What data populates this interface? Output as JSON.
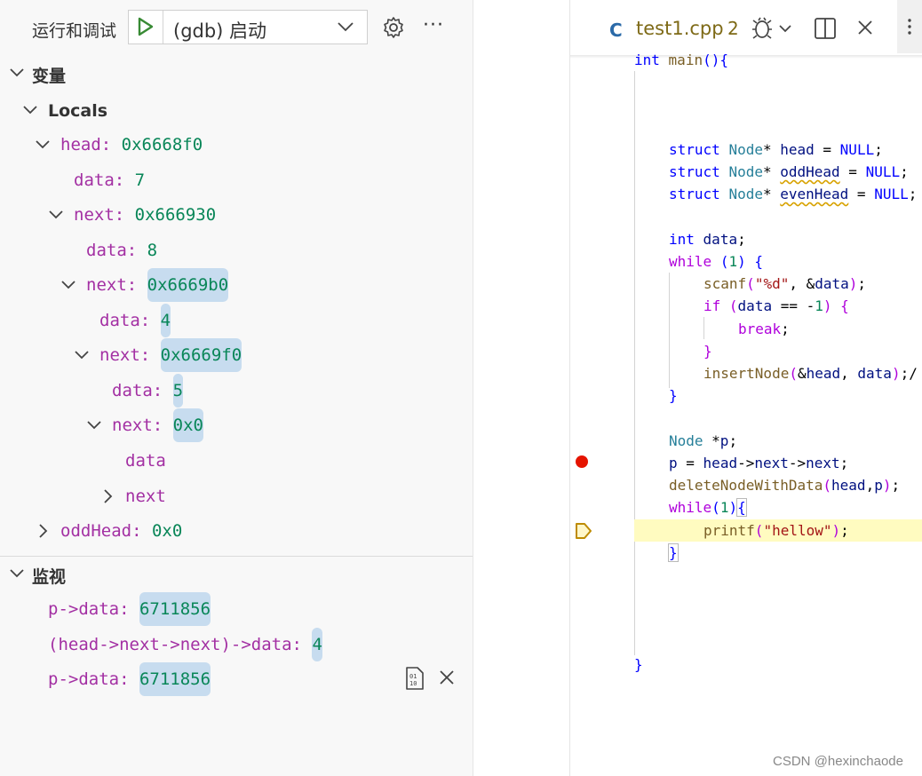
{
  "sidebar": {
    "title": "运行和调试",
    "config": "(gdb) 启动",
    "more": "···",
    "variables_header": "变量",
    "locals_header": "Locals",
    "variables": [
      {
        "key": "head",
        "value": "0x6668f0"
      },
      {
        "key": "data",
        "value": "7"
      },
      {
        "key": "next",
        "value": "0x666930"
      },
      {
        "key": "data",
        "value": "8"
      },
      {
        "key": "next",
        "value": "0x6669b0"
      },
      {
        "key": "data",
        "value": "4"
      },
      {
        "key": "next",
        "value": "0x6669f0"
      },
      {
        "key": "data",
        "value": "5"
      },
      {
        "key": "next",
        "value": "0x0"
      },
      {
        "key": "data",
        "value": ""
      },
      {
        "key": "next",
        "value": ""
      },
      {
        "key": "oddHead",
        "value": "0x0"
      }
    ],
    "watch_header": "监视",
    "watch": [
      {
        "expr": "p->data",
        "value": "6711856"
      },
      {
        "expr": "(head->next->next)->data",
        "value": "4"
      },
      {
        "expr": "p->data",
        "value": "6711856"
      }
    ]
  },
  "editor": {
    "tab_icon": "C",
    "tab_name": "test1.cpp",
    "tab_problems": "2",
    "watermark": "CSDN @hexinchaode"
  }
}
